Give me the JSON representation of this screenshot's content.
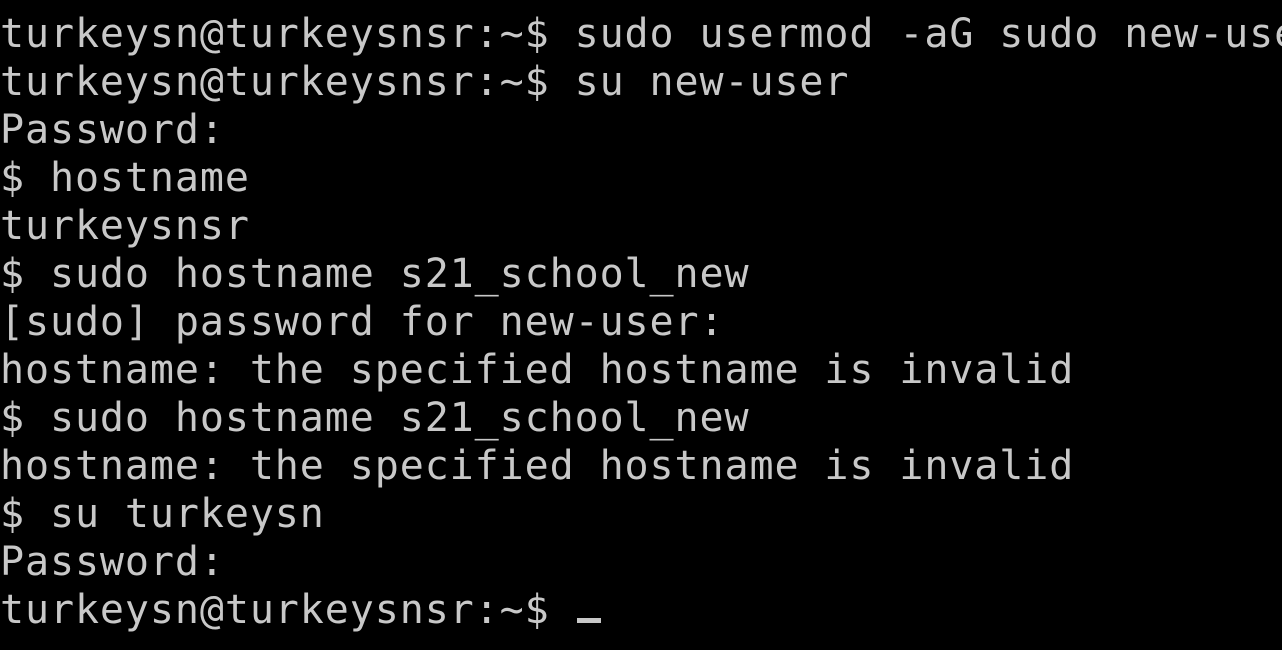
{
  "terminal": {
    "lines": [
      "",
      "turkeysn@turkeysnsr:~$ sudo usermod -aG sudo new-user",
      "turkeysn@turkeysnsr:~$ su new-user",
      "Password:",
      "$ hostname",
      "turkeysnsr",
      "$ sudo hostname s21_school_new",
      "[sudo] password for new-user:",
      "hostname: the specified hostname is invalid",
      "$ sudo hostname s21_school_new",
      "hostname: the specified hostname is invalid",
      "$ su turkeysn",
      "Password:",
      "turkeysn@turkeysnsr:~$ "
    ],
    "foreground_color": "#c8c8c8",
    "background_color": "#000000"
  }
}
